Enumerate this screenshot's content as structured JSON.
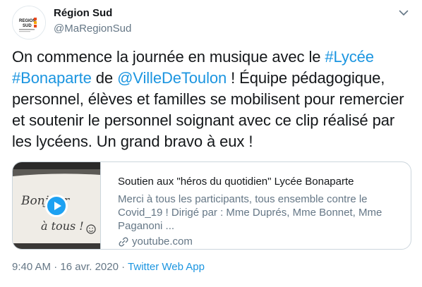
{
  "author": {
    "display_name": "Région Sud",
    "handle": "@MaRegionSud",
    "avatar_logo_text": "REGION SUD"
  },
  "tweet": {
    "segments": [
      {
        "text": "On commence la journée en musique avec le ",
        "link": false
      },
      {
        "text": "#Lycée",
        "link": true
      },
      {
        "text": " ",
        "link": false
      },
      {
        "text": "#Bonaparte",
        "link": true
      },
      {
        "text": " de ",
        "link": false
      },
      {
        "text": "@VilleDeToulon",
        "link": true
      },
      {
        "text": " ! Équipe pédagogique, personnel, élèves et familles se mobilisent pour remercier et soutenir le personnel soignant avec ce clip réalisé par les lycéens. Un grand bravo à eux !",
        "link": false
      }
    ]
  },
  "card": {
    "title": "Soutien aux \"héros du quotidien\" Lycée Bonaparte",
    "description": "Merci à tous les participants, tous ensemble contre le Covid_19 ! Dirigé par : Mme Duprés, Mme Bonnet, Mme Paganoni ...",
    "domain": "youtube.com",
    "thumbnail_text_line1": "Bonjour",
    "thumbnail_text_line2": "à tous !"
  },
  "meta": {
    "time": "9:40 AM",
    "separator": " · ",
    "date": "16 avr. 2020",
    "source": "Twitter Web App"
  },
  "colors": {
    "link": "#1b95e0",
    "muted": "#657786",
    "text": "#14171a",
    "play": "#1da1f2"
  },
  "icons": {
    "more": "chevron-down-icon",
    "domain": "link-icon",
    "play": "play-icon"
  }
}
